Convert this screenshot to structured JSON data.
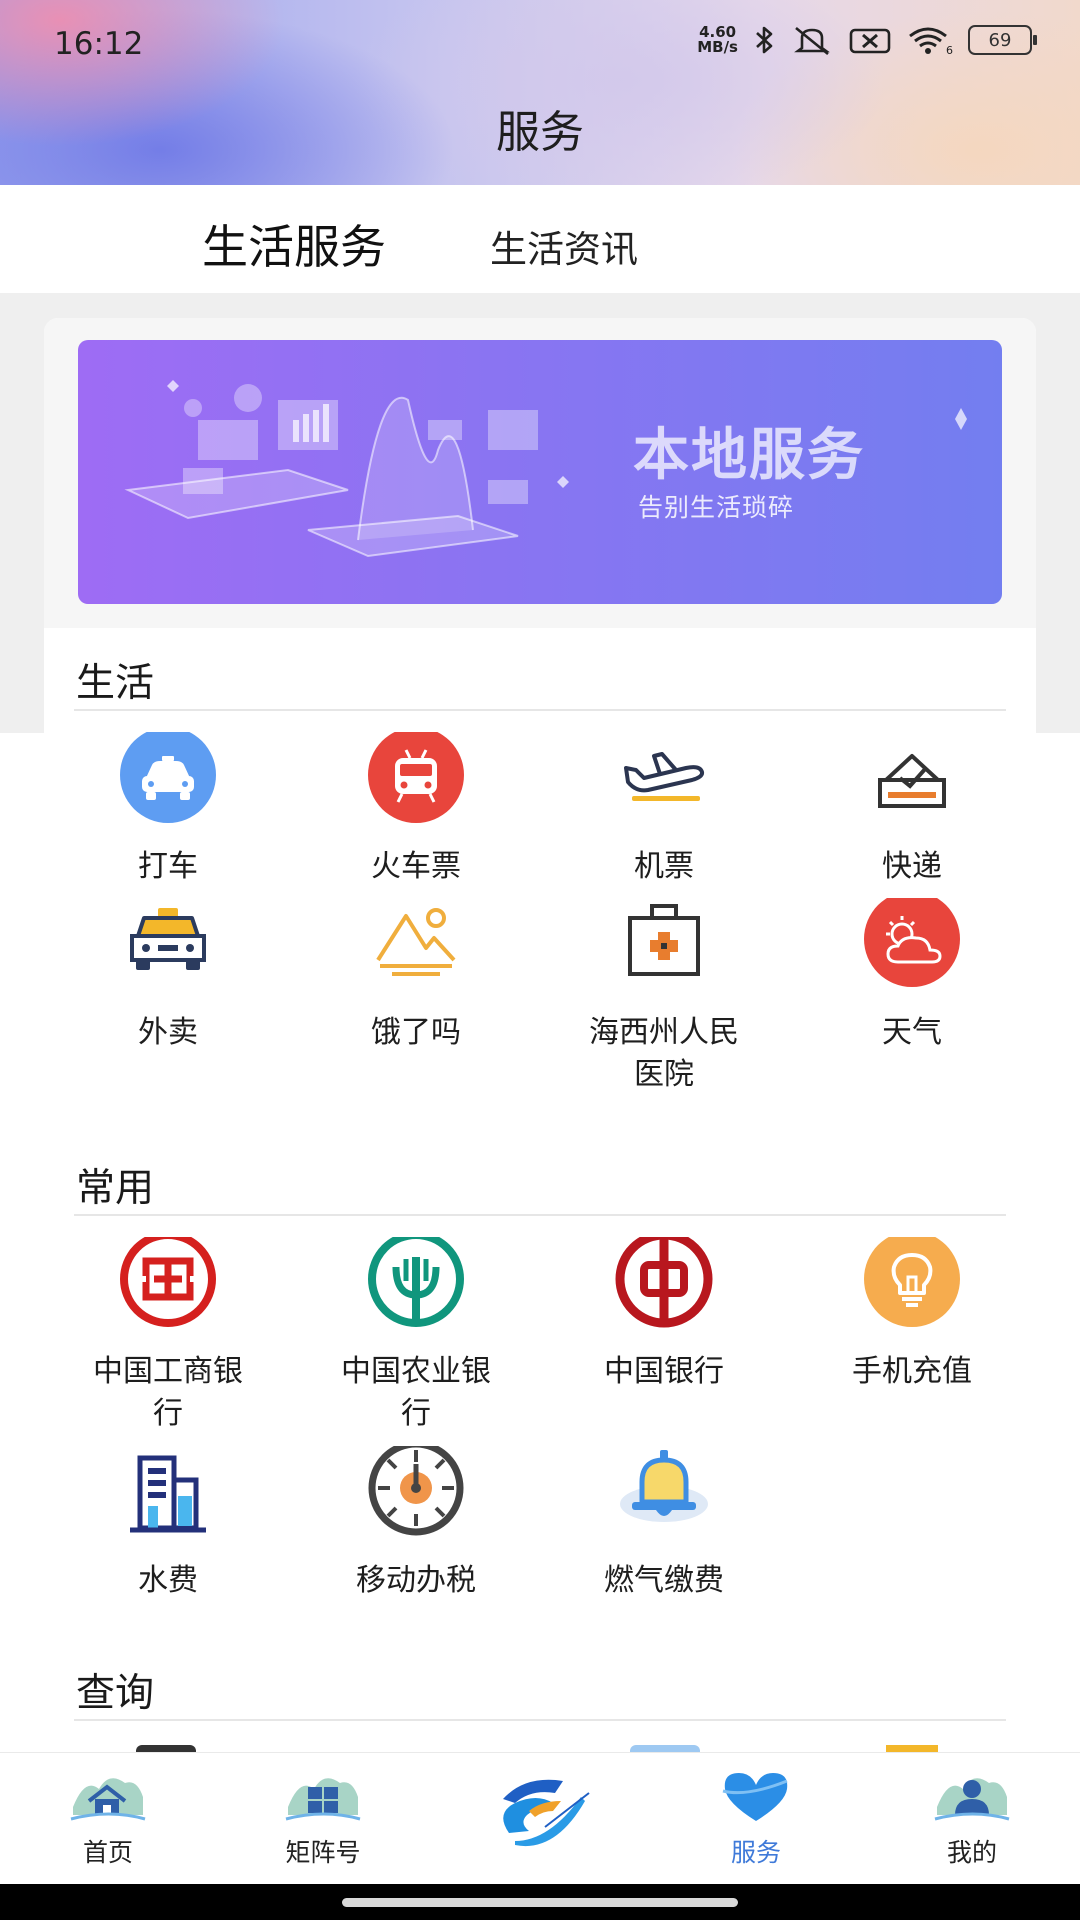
{
  "status_bar": {
    "time": "16:12",
    "net_speed_value": "4.60",
    "net_speed_unit": "MB/s",
    "battery": "69"
  },
  "header": {
    "title": "服务"
  },
  "segment_tabs": [
    {
      "label": "生活服务",
      "active": true
    },
    {
      "label": "生活资讯",
      "active": false
    }
  ],
  "banner": {
    "title": "本地服务",
    "subtitle": "告别生活琐碎"
  },
  "sections": {
    "life": {
      "title": "生活",
      "items": [
        {
          "label": "打车",
          "icon": "taxi-icon"
        },
        {
          "label": "火车票",
          "icon": "train-icon"
        },
        {
          "label": "机票",
          "icon": "airplane-icon"
        },
        {
          "label": "快递",
          "icon": "parcel-icon"
        },
        {
          "label": "外卖",
          "icon": "delivery-car-icon"
        },
        {
          "label": "饿了吗",
          "icon": "mountain-icon"
        },
        {
          "label": "海西州人民医院",
          "icon": "medical-kit-icon"
        },
        {
          "label": "天气",
          "icon": "weather-icon"
        }
      ]
    },
    "common": {
      "title": "常用",
      "items": [
        {
          "label": "中国工商银行",
          "icon": "icbc-icon"
        },
        {
          "label": "中国农业银行",
          "icon": "abc-bank-icon"
        },
        {
          "label": "中国银行",
          "icon": "boc-bank-icon"
        },
        {
          "label": "手机充值",
          "icon": "bulb-icon"
        },
        {
          "label": "水费",
          "icon": "building-icon"
        },
        {
          "label": "移动办税",
          "icon": "tax-dial-icon"
        },
        {
          "label": "燃气缴费",
          "icon": "bell-icon"
        }
      ]
    },
    "query": {
      "title": "查询"
    }
  },
  "bottom_nav": [
    {
      "label": "首页",
      "icon": "home-icon",
      "active": false
    },
    {
      "label": "矩阵号",
      "icon": "matrix-icon",
      "active": false
    },
    {
      "label": "",
      "icon": "center-logo-icon",
      "active": false
    },
    {
      "label": "服务",
      "icon": "heart-icon",
      "active": true
    },
    {
      "label": "我的",
      "icon": "profile-icon",
      "active": false
    }
  ],
  "colors": {
    "accent": "#3f7ad9",
    "banner_start": "#9e6cf4",
    "banner_end": "#737ef0"
  }
}
